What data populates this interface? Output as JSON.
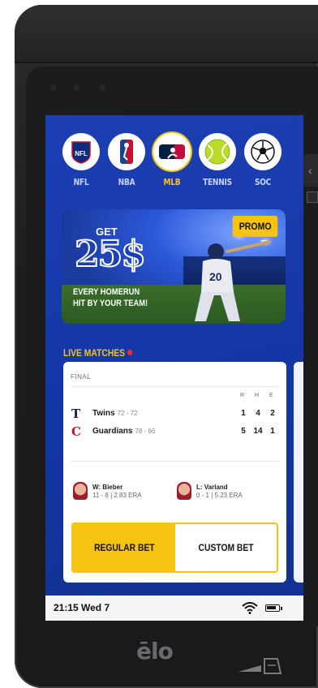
{
  "sports": [
    {
      "label": "NFL",
      "icon": "nfl-logo-icon",
      "active": false
    },
    {
      "label": "NBA",
      "icon": "nba-logo-icon",
      "active": false
    },
    {
      "label": "MLB",
      "icon": "mlb-logo-icon",
      "active": true
    },
    {
      "label": "TENNIS",
      "icon": "tennis-ball-icon",
      "active": false
    },
    {
      "label": "SOC",
      "icon": "soccer-ball-icon",
      "active": false
    }
  ],
  "promo": {
    "get": "GET",
    "amount": "25$",
    "line1": "EVERY HOMERUN",
    "line2": "HIT BY YOUR TEAM!",
    "badge": "PROMO",
    "jersey_number": "20"
  },
  "live": {
    "title": "LIVE MATCHES",
    "status": "FINAL",
    "columns": [
      "R",
      "H",
      "E"
    ],
    "teams": [
      {
        "name": "Twins",
        "record": "72 - 72",
        "logo": "T",
        "color": "#0c2340",
        "scores": [
          "1",
          "4",
          "2"
        ]
      },
      {
        "name": "Guardians",
        "record": "78 - 66",
        "logo": "C",
        "color": "#c8102e",
        "scores": [
          "5",
          "14",
          "1"
        ]
      }
    ],
    "winner": {
      "name": "W: Bieber",
      "stats": "11 - 8 | 2.83 ERA"
    },
    "loser": {
      "name": "L: Varland",
      "stats": "0 - 1 | 5.23 ERA"
    },
    "regular_bet": "REGULAR BET",
    "custom_bet": "CUSTOM BET"
  },
  "status_bar": {
    "time": "21:15  Wed 7"
  },
  "brand": "ēlo",
  "colors": {
    "accent": "#f7c313",
    "screen_blue": "#1c3fb3",
    "live_dot": "#ff2a2a"
  }
}
